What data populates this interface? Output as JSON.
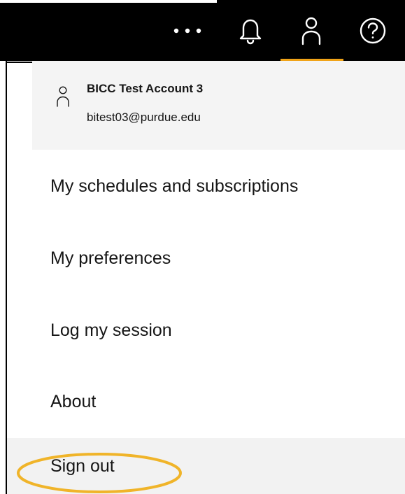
{
  "header": {
    "icons": [
      "more-icon",
      "notification-bell-icon",
      "user-icon",
      "help-icon"
    ],
    "active_icon": "user-icon",
    "accent_color": "#f0a318",
    "background_color": "#000000"
  },
  "account": {
    "name": "BICC Test Account 3",
    "email": "bitest03@purdue.edu"
  },
  "menu": {
    "items": [
      {
        "label": "My schedules and subscriptions"
      },
      {
        "label": "My preferences"
      },
      {
        "label": "Log my session"
      },
      {
        "label": "About"
      },
      {
        "label": "Sign out"
      }
    ],
    "highlighted_item": "Sign out",
    "highlight_color": "#f0b429"
  }
}
